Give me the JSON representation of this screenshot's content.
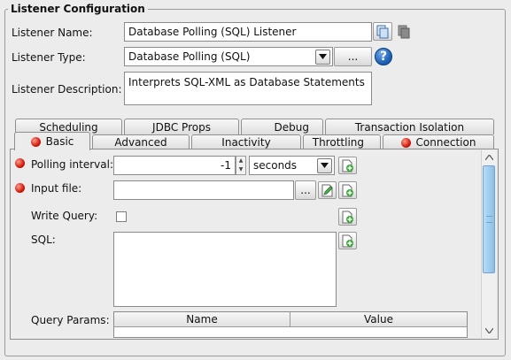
{
  "section": {
    "title": "Listener Configuration"
  },
  "form": {
    "name_label": "Listener Name:",
    "name_value": "Database Polling (SQL) Listener",
    "type_label": "Listener Type:",
    "type_value": "Database Polling (SQL)",
    "type_browse": "...",
    "description_label": "Listener Description:",
    "description_value": "Interprets SQL-XML as Database Statements"
  },
  "tabs": {
    "row1": [
      "Scheduling",
      "JDBC Props",
      "Debug",
      "Transaction Isolation"
    ],
    "row2": [
      "Basic",
      "Advanced",
      "Inactivity",
      "Throttling",
      "Connection"
    ],
    "active": "Basic"
  },
  "basic": {
    "polling_label": "Polling interval:",
    "polling_value": "-1",
    "polling_unit": "seconds",
    "input_file_label": "Input file:",
    "input_file_value": "",
    "input_file_browse": "...",
    "write_query_label": "Write Query:",
    "write_query_checked": false,
    "sql_label": "SQL:",
    "sql_value": "",
    "query_params_label": "Query Params:",
    "query_params_columns": [
      "Name",
      "Value"
    ]
  },
  "icons": {
    "copy": "copy-icon",
    "info": "help-icon",
    "add": "add-document-icon",
    "edit": "edit-document-icon",
    "required": "required-indicator-icon"
  },
  "colors": {
    "required": "#d01a0a",
    "help": "#1a5fb4",
    "scroll_thumb": "#9cc7ea"
  }
}
